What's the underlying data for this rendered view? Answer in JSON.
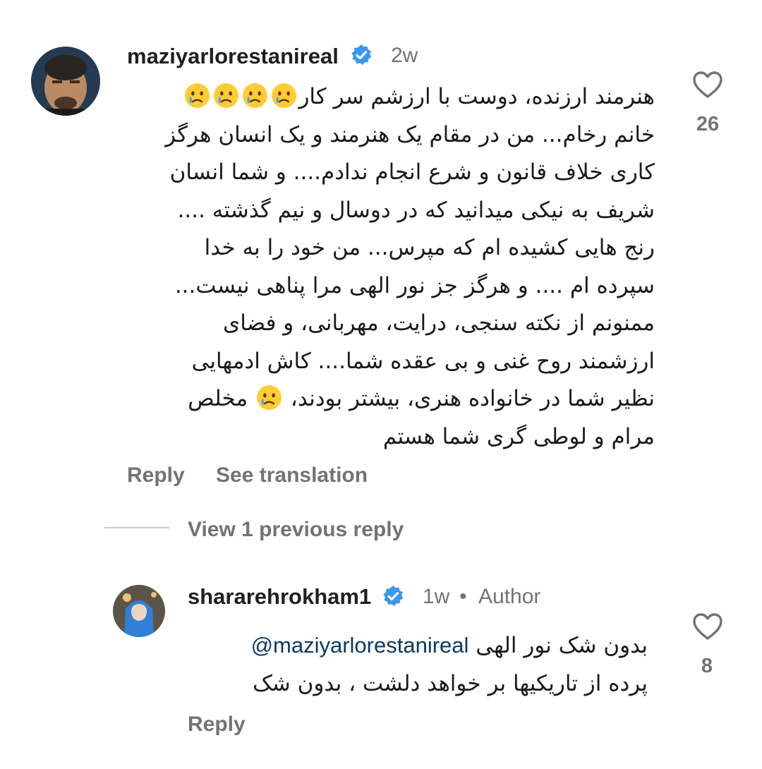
{
  "comments": [
    {
      "username": "maziyarlorestanireal",
      "time": "2w",
      "likes": "26",
      "lines": [
        "هنرمند ارزنده، دوست با ارزشم سر کار",
        "خانم رخام... من در مقام یک هنرمند و یک انسان هرگز",
        "کاری خلاف قانون و شرع انجام ندادم.... و شما انسان",
        "شریف به نیکی میدانید که در دوسال و نیم گذشته ....",
        "رنج هایی کشیده ام که مپرس... من خود را به خدا",
        "سپرده ام .... و هرگز جز نور الهی مرا پناهی نیست...",
        "ممنونم از نکته سنجی، درایت، مهربانی، و فضای",
        "ارزشمند روح غنی و بی عقده شما.... کاش ادمهایی",
        "نظیر شما در خانواده هنری، بیشتر بودند، ",
        "مخلص",
        "مرام و لوطی گری شما هستم"
      ],
      "emojis": [
        "crying-face",
        "crying-face",
        "crying-face",
        "crying-face",
        "crying-face"
      ],
      "reply_label": "Reply",
      "translate_label": "See translation"
    },
    {
      "username": "sharareh rokham1",
      "username_display": "shararehrokham1",
      "time": "1w",
      "separator": "•",
      "author_label": "Author",
      "likes": "8",
      "mention": "@maziyarlorestanireal",
      "line1": "بدون شک نور الهی",
      "line2": "پرده از تاریکیها بر خواهد دلشت ، بدون شک",
      "reply_label": "Reply"
    }
  ],
  "view_replies_label": "View 1 previous reply",
  "colors": {
    "verified": "#3897f0",
    "secondary_text": "#737373",
    "mention": "#0b3a66",
    "emoji_face": "#ffcc33"
  },
  "icons": {
    "like": "heart-outline-icon",
    "verified": "verified-badge-icon"
  }
}
